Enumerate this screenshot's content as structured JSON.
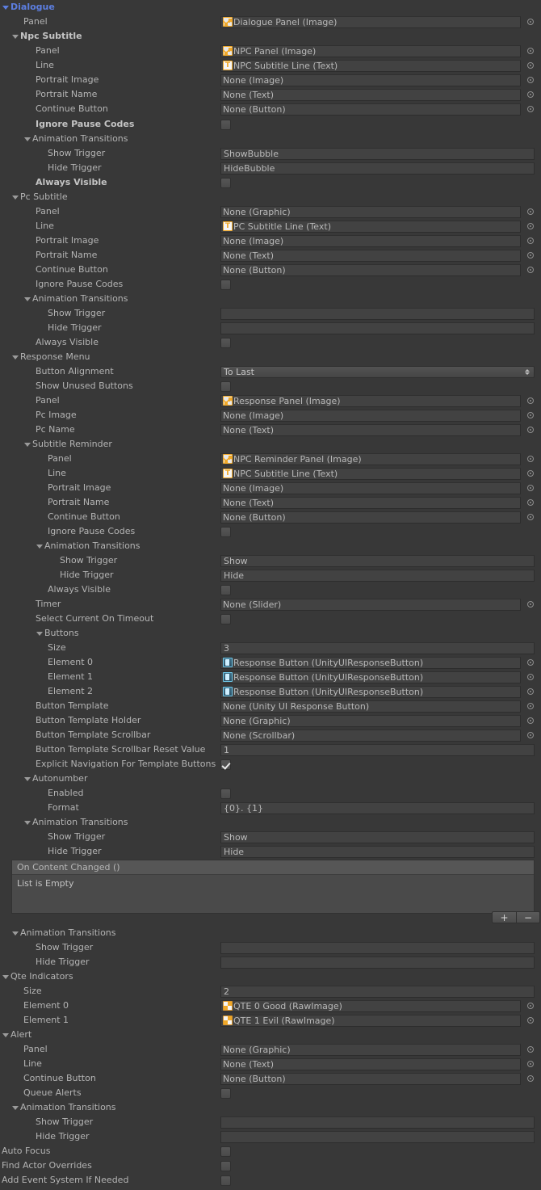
{
  "window": {
    "title": "Dialogue",
    "accent_blue": "#5c7ee0",
    "background": "#383838"
  },
  "labels": {
    "dialogue": "Dialogue",
    "panel": "Panel",
    "npc_subtitle": "Npc Subtitle",
    "line": "Line",
    "portrait_image": "Portrait Image",
    "portrait_name": "Portrait Name",
    "continue_button": "Continue Button",
    "ignore_pause_codes": "Ignore Pause Codes",
    "animation_transitions": "Animation Transitions",
    "show_trigger": "Show Trigger",
    "hide_trigger": "Hide Trigger",
    "always_visible": "Always Visible",
    "pc_subtitle": "Pc Subtitle",
    "response_menu": "Response Menu",
    "button_alignment": "Button Alignment",
    "show_unused_buttons": "Show Unused Buttons",
    "pc_image": "Pc Image",
    "pc_name": "Pc Name",
    "subtitle_reminder": "Subtitle Reminder",
    "timer": "Timer",
    "select_current_on_timeout": "Select Current On Timeout",
    "buttons": "Buttons",
    "size": "Size",
    "element_0": "Element 0",
    "element_1": "Element 1",
    "element_2": "Element 2",
    "button_template": "Button Template",
    "button_template_holder": "Button Template Holder",
    "button_template_scrollbar": "Button Template Scrollbar",
    "button_template_scrollbar_reset_value": "Button Template Scrollbar Reset Value",
    "explicit_navigation": "Explicit Navigation For Template Buttons",
    "autonumber": "Autonumber",
    "enabled": "Enabled",
    "format": "Format",
    "qte_indicators": "Qte Indicators",
    "alert": "Alert",
    "queue_alerts": "Queue Alerts",
    "auto_focus": "Auto Focus",
    "find_actor_overrides": "Find Actor Overrides",
    "add_event_system_if_needed": "Add Event System If Needed"
  },
  "values": {
    "dialogue_panel": "Dialogue Panel (Image)",
    "npc_panel": "NPC Panel (Image)",
    "npc_subtitle_line": "NPC Subtitle Line (Text)",
    "none_image": "None (Image)",
    "none_text": "None (Text)",
    "none_button": "None (Button)",
    "none_graphic": "None (Graphic)",
    "none_slider": "None (Slider)",
    "none_scrollbar": "None (Scrollbar)",
    "none_unity_ui_response_button": "None (Unity UI Response Button)",
    "show_bubble": "ShowBubble",
    "hide_bubble": "HideBubble",
    "pc_subtitle_line": "PC Subtitle Line (Text)",
    "empty": "",
    "to_last": "To Last",
    "response_panel": "Response Panel (Image)",
    "npc_reminder_panel": "NPC Reminder Panel (Image)",
    "show": "Show",
    "hide": "Hide",
    "buttons_size": "3",
    "response_button": "Response Button (UnityUIResponseButton)",
    "scrollbar_reset_value": "1",
    "autonumber_format": "{0}. {1}",
    "qte_size": "2",
    "qte_0": "QTE 0 Good (RawImage)",
    "qte_1": "QTE 1 Evil (RawImage)"
  },
  "event": {
    "header": "On Content Changed ()",
    "empty_text": "List is Empty",
    "add_label": "+",
    "remove_label": "−"
  }
}
